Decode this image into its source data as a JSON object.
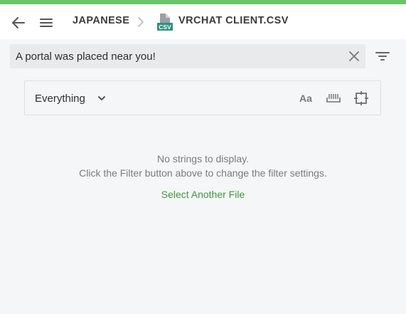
{
  "header": {
    "breadcrumb_language": "JAPANESE",
    "file_type_badge": "CSV",
    "breadcrumb_file": "VRCHAT CLIENT.CSV"
  },
  "search": {
    "value": "A portal was placed near you!"
  },
  "filter_panel": {
    "scope_selected": "Everything",
    "match_case_label": "Aa"
  },
  "empty_state": {
    "line1": "No strings to display.",
    "line2": "Click the Filter button above to change the filter settings.",
    "action_label": "Select Another File"
  },
  "colors": {
    "accent": "#6cc46a",
    "link": "#3d9a3d",
    "file_icon": "#2f8f80"
  }
}
